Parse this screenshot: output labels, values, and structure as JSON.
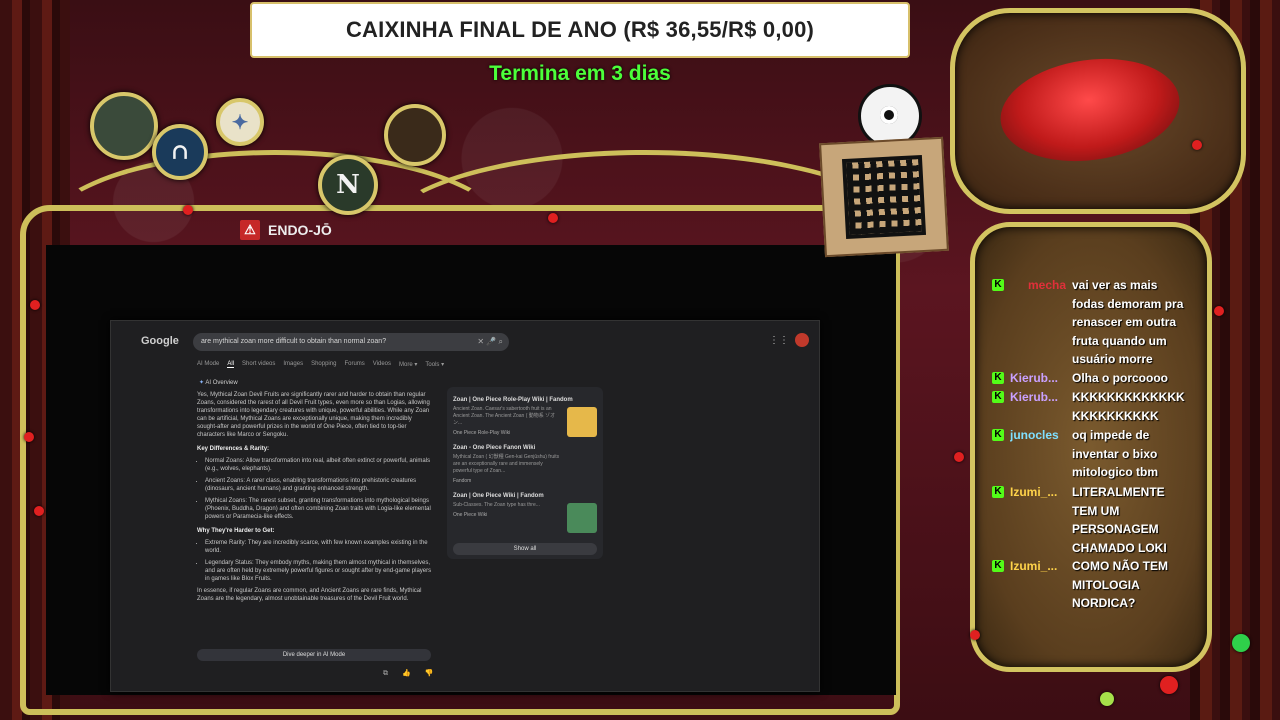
{
  "overlay": {
    "donation_title": "CAIXINHA FINAL DE ANO (R$ 36,55/R$ 0,00)",
    "countdown": "Termina em 3 dias",
    "countdown_color": "#4cff3a",
    "badges": [
      "N"
    ]
  },
  "stream": {
    "title": "ENDO-JŌ"
  },
  "browser": {
    "logo": "Google",
    "search_query": "are mythical zoan more difficult to obtain than normal zoan?",
    "tabs": [
      "AI Mode",
      "All",
      "Short videos",
      "Images",
      "Shopping",
      "Forums",
      "Videos",
      "More ▾",
      "Tools ▾"
    ],
    "active_tab": "All",
    "ai_overview_label": "AI Overview",
    "intro": "Yes, Mythical Zoan Devil Fruits are significantly rarer and harder to obtain than regular Zoans, considered the rarest of all Devil Fruit types, even more so than Logias, allowing transformations into legendary creatures with unique, powerful abilities. While any Zoan can be artificial, Mythical Zoans are exceptionally unique, making them incredibly sought-after and powerful prizes in the world of One Piece, often tied to top-tier characters like Marco or Sengoku.",
    "section1_title": "Key Differences & Rarity:",
    "section1_items": [
      "Normal Zoans: Allow transformation into real, albeit often extinct or powerful, animals (e.g., wolves, elephants).",
      "Ancient Zoans: A rarer class, enabling transformations into prehistoric creatures (dinosaurs, ancient humans) and granting enhanced strength.",
      "Mythical Zoans: The rarest subset, granting transformations into mythological beings (Phoenix, Buddha, Dragon) and often combining Zoan traits with Logia-like elemental powers or Paramecia-like effects."
    ],
    "section2_title": "Why They're Harder to Get:",
    "section2_items": [
      "Extreme Rarity: They are incredibly scarce, with few known examples existing in the world.",
      "Legendary Status: They embody myths, making them almost mythical in themselves, and are often held by extremely powerful figures or sought after by end-game players in games like Blox Fruits."
    ],
    "conclusion": "In essence, if regular Zoans are common, and Ancient Zoans are rare finds, Mythical Zoans are the legendary, almost unobtainable treasures of the Devil Fruit world.",
    "dive_deeper": "Dive deeper in AI Mode",
    "feedback_icons": "⧉ 👍 👎",
    "sources": [
      {
        "title": "Zoan | One Piece Role-Play Wiki | Fandom",
        "snippet": "Ancient Zoan. Caesar's sabertooth fruit is an Ancient Zoan. The Ancient Zoan ( 動物系 ゾオン...",
        "site": "One Piece Role-Play Wiki",
        "thumb_color": "#e6b84a"
      },
      {
        "title": "Zoan - One Piece Fanon Wiki",
        "snippet": "Mythical Zoan ( 幻獣種 Gen-kai Genjūshu) fruits are an exceptionally rare and immensely powerful type of Zoan...",
        "site": "Fandom",
        "thumb_color": ""
      },
      {
        "title": "Zoan | One Piece Wiki | Fandom",
        "snippet": "Sub-Classes. The Zoan type has thre...",
        "site": "One Piece Wiki",
        "thumb_color": "#4a8a5a"
      }
    ],
    "show_all": "Show all"
  },
  "chat": {
    "platform_icon": "K",
    "platform_color": "#53fc18",
    "messages": [
      {
        "user": "mecha",
        "user_color": "#e0303a",
        "text": "vai ver as mais fodas demoram pra renascer em outra fruta quando um usuário morre"
      },
      {
        "user": "Kierub...",
        "user_color": "#c9a0ff",
        "text": "Olha o porcoooo"
      },
      {
        "user": "Kierub...",
        "user_color": "#c9a0ff",
        "text": "KKKKKKKKKKKKK KKKKKKKKKK"
      },
      {
        "user": "junocles",
        "user_color": "#7fe0ff",
        "text": "oq impede de inventar o bixo mitologico tbm"
      },
      {
        "user": "Izumi_...",
        "user_color": "#ffd34a",
        "text": "LITERALMENTE TEM UM PERSONAGEM CHAMADO LOKI"
      },
      {
        "user": "Izumi_...",
        "user_color": "#ffd34a",
        "text": "COMO NÃO TEM MITOLOGIA NORDICA?"
      }
    ]
  }
}
